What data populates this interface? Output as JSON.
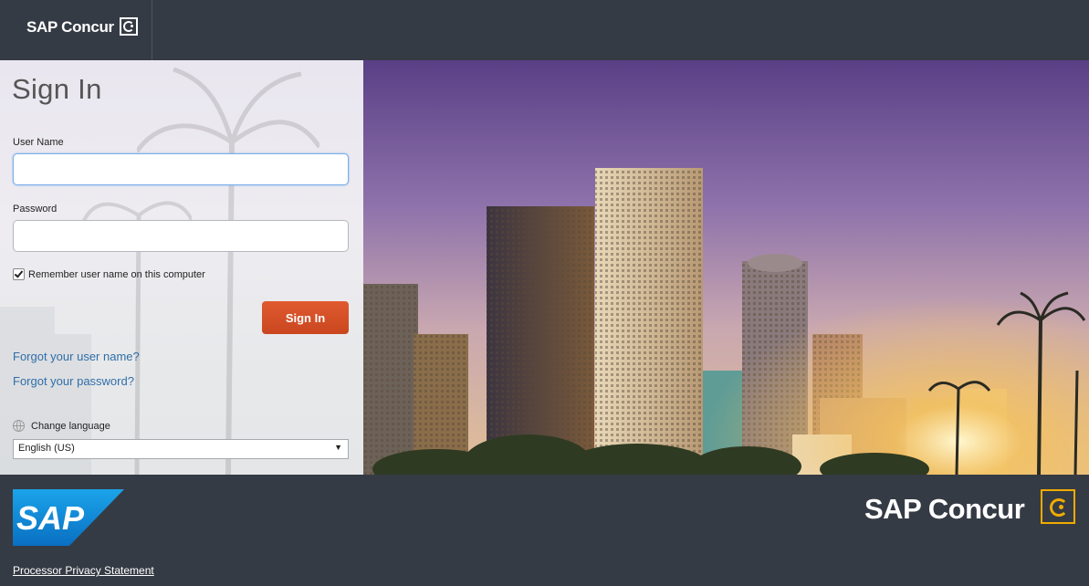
{
  "header": {
    "brand": "SAP Concur"
  },
  "login": {
    "title": "Sign In",
    "username_label": "User Name",
    "username_value": "",
    "password_label": "Password",
    "password_value": "",
    "remember_label": "Remember user name on this computer",
    "remember_checked": true,
    "signin_label": "Sign In",
    "forgot_username": "Forgot your user name?",
    "forgot_password": "Forgot your password?",
    "change_language": "Change language",
    "language_selected": "English (US)"
  },
  "footer": {
    "sap_logo_text": "SAP",
    "brand": "SAP Concur",
    "privacy_link": "Processor Privacy Statement"
  },
  "colors": {
    "topbar": "#353b44",
    "signin_button": "#d4522a",
    "link": "#2f6fa8",
    "concur_logo_accent": "#f0ab00",
    "sap_logo_blue": "#1088d8"
  }
}
